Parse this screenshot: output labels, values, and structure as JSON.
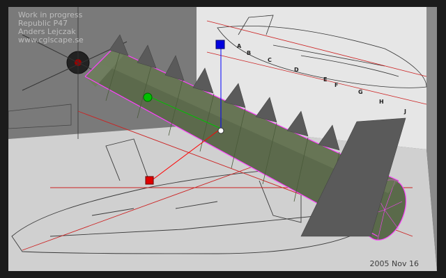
{
  "overlay": {
    "lines": [
      "Work in progress",
      "Republic P47",
      "Anders Lejczak",
      "www.cglscape.se"
    ]
  },
  "date_stamp": "2005 Nov 16",
  "blueprint_labels": [
    "A",
    "B",
    "C",
    "D",
    "E",
    "F",
    "G",
    "H",
    "J"
  ],
  "colors": {
    "background": "#6e6e6e",
    "blueprint_wall": "#e8e8e8",
    "floor": "#d2d2d2",
    "fuselage": "#5c6a4c",
    "selection_edge": "#ff40ff",
    "axis_x": "#ff0000",
    "axis_y": "#00c000",
    "axis_z": "#0000ff"
  },
  "gizmo": {
    "x_handle": "red-cube-icon",
    "y_handle": "green-sphere-icon",
    "z_handle": "blue-cube-icon"
  }
}
